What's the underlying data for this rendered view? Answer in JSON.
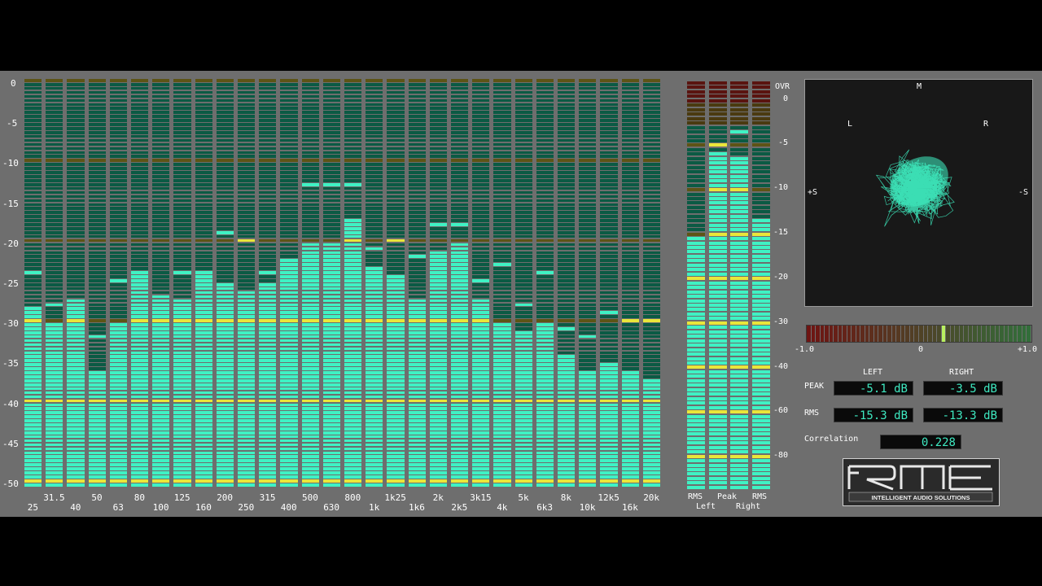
{
  "analyzer": {
    "db_ticks": [
      "0",
      "-5",
      "-10",
      "-15",
      "-20",
      "-25",
      "-30",
      "-35",
      "-40",
      "-45",
      "-50"
    ],
    "freq_labels_top": [
      "31.5",
      "50",
      "80",
      "125",
      "200",
      "315",
      "500",
      "800",
      "1k25",
      "2k",
      "3k15",
      "5k",
      "8k",
      "12k5",
      "20k"
    ],
    "freq_labels_bottom": [
      "25",
      "40",
      "63",
      "100",
      "160",
      "250",
      "400",
      "630",
      "1k",
      "1k6",
      "2k5",
      "4k",
      "6k3",
      "10k",
      "16k"
    ],
    "bands": [
      {
        "level_db": -28.5,
        "peak_db": -24
      },
      {
        "level_db": -30.5,
        "peak_db": -28
      },
      {
        "level_db": -27.5,
        "peak_db": -28
      },
      {
        "level_db": -36.5,
        "peak_db": -32
      },
      {
        "level_db": -30.5,
        "peak_db": -25
      },
      {
        "level_db": -24,
        "peak_db": -24
      },
      {
        "level_db": -27.5,
        "peak_db": -27
      },
      {
        "level_db": -27.5,
        "peak_db": -24
      },
      {
        "level_db": -24,
        "peak_db": -24
      },
      {
        "level_db": -25.5,
        "peak_db": -19
      },
      {
        "level_db": -26.5,
        "peak_db": -20
      },
      {
        "level_db": -25.5,
        "peak_db": -24
      },
      {
        "level_db": -22.5,
        "peak_db": -23
      },
      {
        "level_db": -20.5,
        "peak_db": -13
      },
      {
        "level_db": -20.5,
        "peak_db": -13
      },
      {
        "level_db": -17.5,
        "peak_db": -13
      },
      {
        "level_db": -23.5,
        "peak_db": -21
      },
      {
        "level_db": -24.5,
        "peak_db": -20
      },
      {
        "level_db": -27.5,
        "peak_db": -22
      },
      {
        "level_db": -21.5,
        "peak_db": -18
      },
      {
        "level_db": -20.5,
        "peak_db": -18
      },
      {
        "level_db": -27.5,
        "peak_db": -25
      },
      {
        "level_db": -30.5,
        "peak_db": -23
      },
      {
        "level_db": -31.5,
        "peak_db": -28
      },
      {
        "level_db": -30.5,
        "peak_db": -24
      },
      {
        "level_db": -34.5,
        "peak_db": -31
      },
      {
        "level_db": -36.5,
        "peak_db": -32
      },
      {
        "level_db": -35.5,
        "peak_db": -29
      },
      {
        "level_db": -36.5,
        "peak_db": -30
      },
      {
        "level_db": -37.5,
        "peak_db": -30
      }
    ]
  },
  "level_meters": {
    "ticks": [
      "OVR",
      "0",
      "-5",
      "-10",
      "-15",
      "-20",
      "-30",
      "-40",
      "-60",
      "-80"
    ],
    "columns": [
      {
        "label_top": "RMS",
        "label_bottom": "Left",
        "level_db": -15.3,
        "peak_db": null
      },
      {
        "label_top": "Peak",
        "label_bottom": "",
        "level_db": -5.8,
        "peak_db": -5.1
      },
      {
        "label_top": "",
        "label_bottom": "Right",
        "level_db": -6.3,
        "peak_db": -3.5
      },
      {
        "label_top": "RMS",
        "label_bottom": "",
        "level_db": -13.3,
        "peak_db": null
      }
    ]
  },
  "goniometer": {
    "label_m": "M",
    "label_l": "L",
    "label_r": "R",
    "label_plus_s": "+S",
    "label_minus_s": "-S"
  },
  "correlation_meter": {
    "min_label": "-1.0",
    "mid_label": "0",
    "max_label": "+1.0",
    "value": 0.228
  },
  "readout": {
    "left_header": "LEFT",
    "right_header": "RIGHT",
    "peak_label": "PEAK",
    "rms_label": "RMS",
    "peak_left": "-5.1 dB",
    "peak_right": "-3.5 dB",
    "rms_left": "-15.3 dB",
    "rms_right": "-13.3 dB",
    "correlation_label": "Correlation",
    "correlation_value": "0.228"
  },
  "logo": {
    "brand": "RME",
    "tagline": "INTELLIGENT AUDIO SOLUTIONS"
  },
  "colors": {
    "lit": "#3ff2c4",
    "unlit": "#0b5a44",
    "marker": "#e9e63a",
    "marker_unlit": "#5d5416",
    "red_unlit": "#5a1410"
  }
}
